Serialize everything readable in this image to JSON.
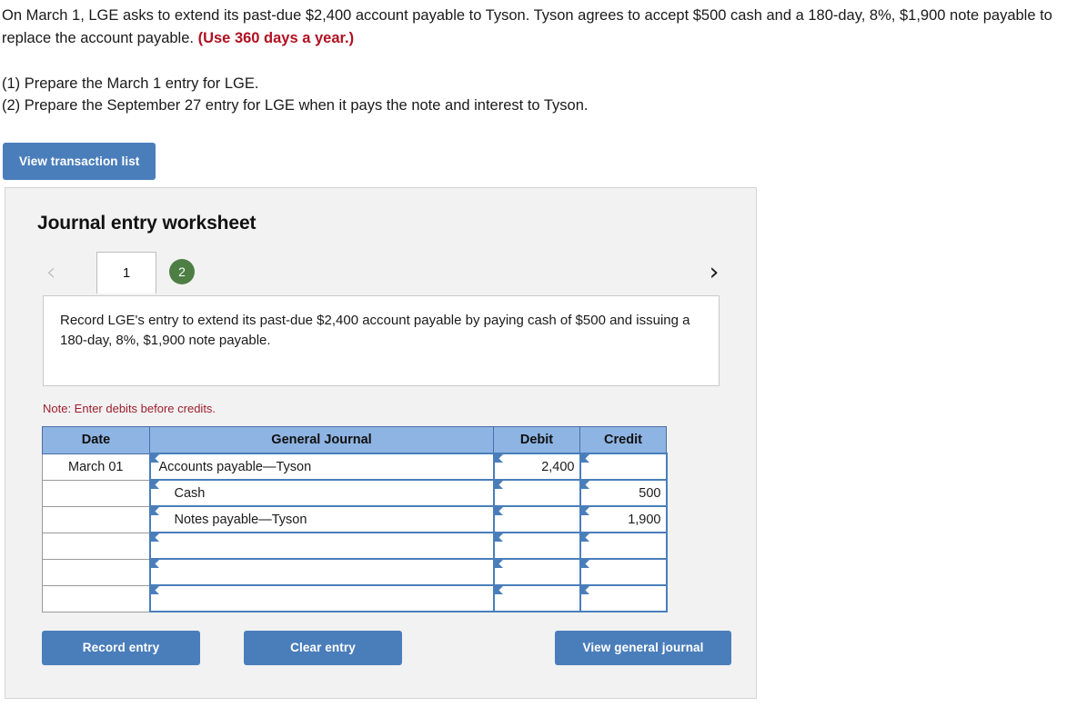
{
  "problem": {
    "line1": "On March 1, LGE asks to extend its past-due $2,400 account payable to Tyson. Tyson agrees to accept $500 cash and a 180-day, 8%,",
    "line2": "$1,900 note payable to replace the account payable",
    "line2_tail": ".",
    "hint": "(Use 360 days a year.)"
  },
  "requirements": {
    "r1": "(1) Prepare the March 1 entry for LGE.",
    "r2": "(2) Prepare the September 27 entry for LGE when it pays the note and interest to Tyson."
  },
  "toolbar": {
    "view_transaction_list": "View transaction list"
  },
  "worksheet": {
    "title": "Journal entry worksheet",
    "prev_icon": "chevron-left-icon",
    "next_icon": "chevron-right-icon",
    "tabs": [
      {
        "label": "1",
        "state": "active"
      },
      {
        "label": "2",
        "state": "badge"
      }
    ],
    "instructions": "Record LGE's entry to extend its past-due $2,400 account payable by paying cash of $500 and issuing a 180-day, 8%, $1,900 note payable.",
    "note": "Note: Enter debits before credits.",
    "table": {
      "headers": [
        "Date",
        "General Journal",
        "Debit",
        "Credit"
      ],
      "rows": [
        {
          "date": "March 01",
          "account": "Accounts payable—Tyson",
          "indent": false,
          "debit": "2,400",
          "credit": ""
        },
        {
          "date": "",
          "account": "Cash",
          "indent": true,
          "debit": "",
          "credit": "500"
        },
        {
          "date": "",
          "account": "Notes payable—Tyson",
          "indent": true,
          "debit": "",
          "credit": "1,900"
        },
        {
          "date": "",
          "account": "",
          "indent": false,
          "debit": "",
          "credit": ""
        },
        {
          "date": "",
          "account": "",
          "indent": false,
          "debit": "",
          "credit": ""
        },
        {
          "date": "",
          "account": "",
          "indent": false,
          "debit": "",
          "credit": ""
        }
      ]
    },
    "buttons": {
      "record_entry": "Record entry",
      "clear_entry": "Clear entry",
      "view_general_journal": "View general journal"
    }
  },
  "colors": {
    "button_blue": "#4a7ebb",
    "header_blue": "#8db4e2",
    "badge_green": "#4d7f45",
    "hint_red": "#b10f20",
    "note_red": "#9c1f2e",
    "panel_bg": "#f2f2f2"
  }
}
